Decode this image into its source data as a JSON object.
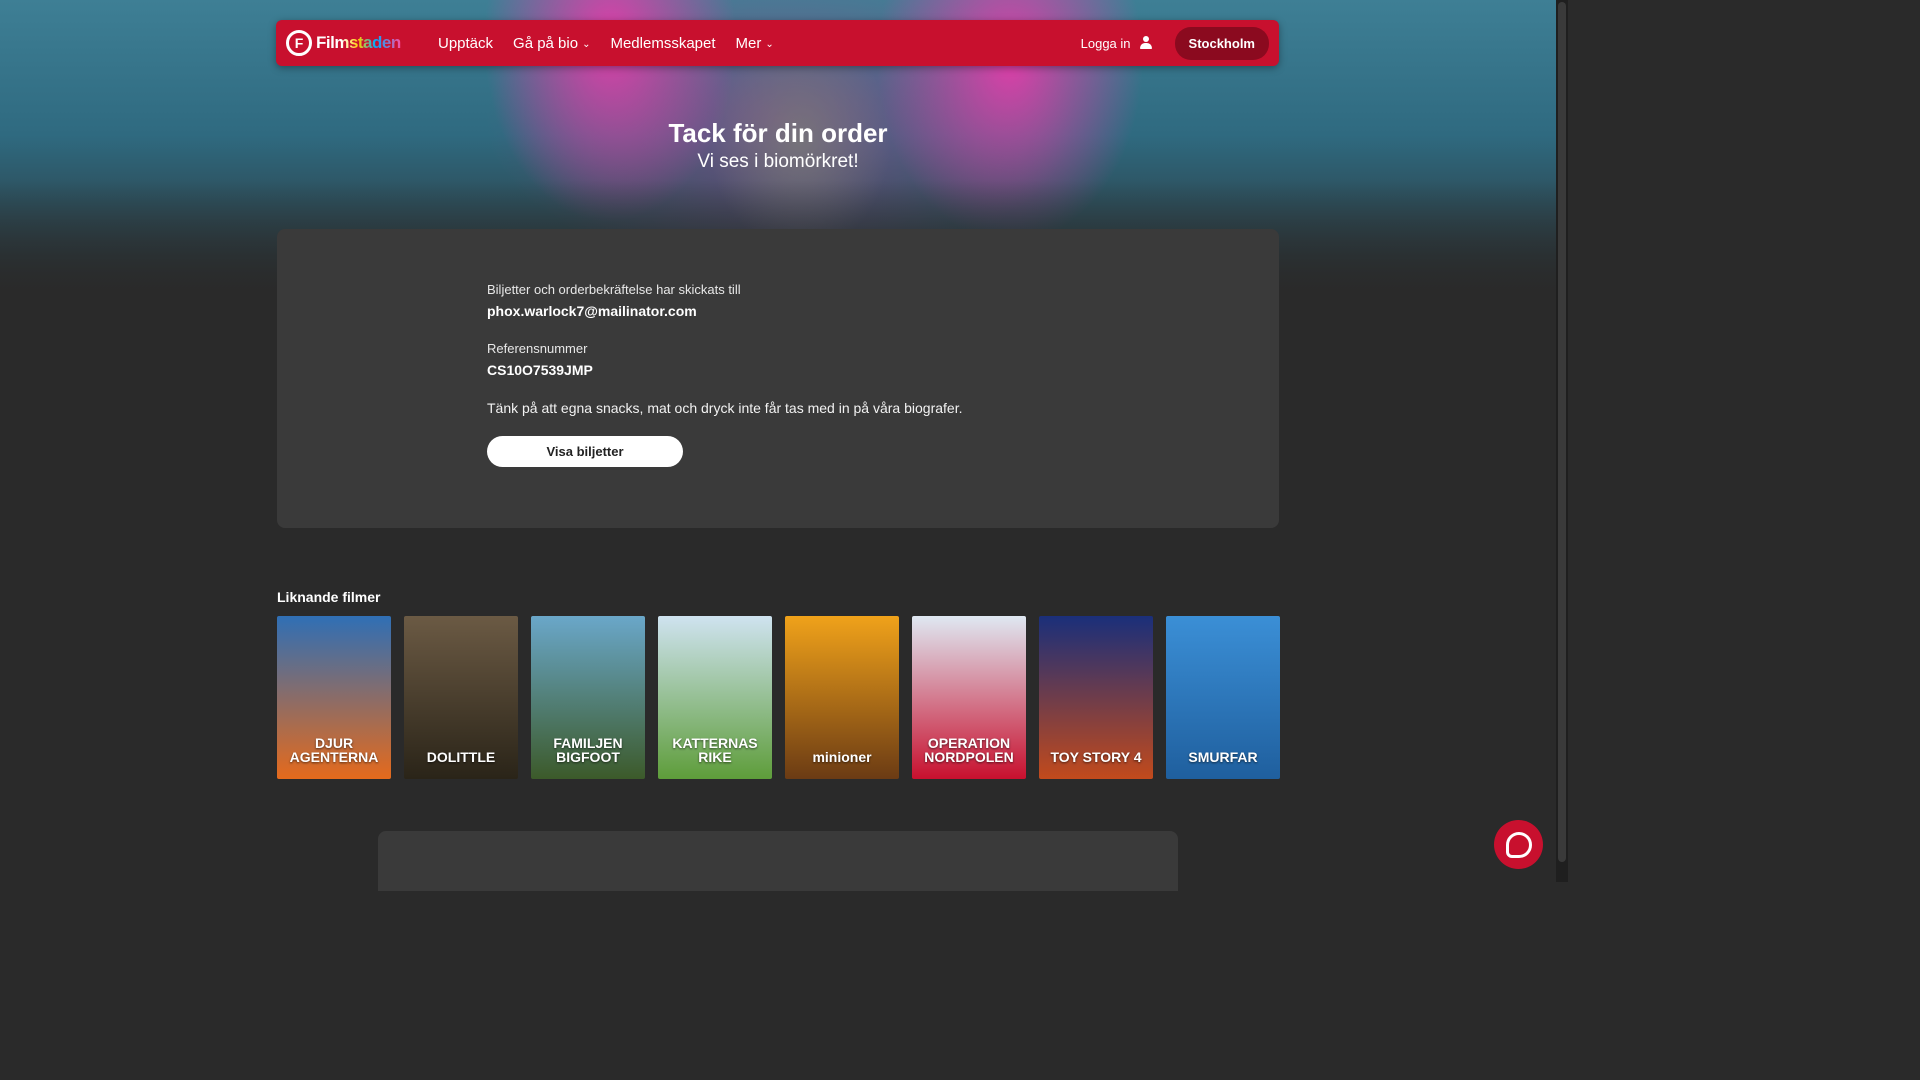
{
  "header": {
    "logo_text": "Filmstaden",
    "nav": [
      {
        "label": "Upptäck",
        "dropdown": false
      },
      {
        "label": "Gå på bio",
        "dropdown": true
      },
      {
        "label": "Medlemsskapet",
        "dropdown": false
      },
      {
        "label": "Mer",
        "dropdown": true
      }
    ],
    "login_label": "Logga in",
    "city_label": "Stockholm"
  },
  "hero": {
    "title": "Tack för din order",
    "subtitle": "Vi ses i biomörkret!"
  },
  "order": {
    "sent_label": "Biljetter och orderbekräftelse har skickats till",
    "email": "phox.warlock7@mailinator.com",
    "ref_label": "Referensnummer",
    "ref_value": "CS10O7539JMP",
    "notice": "Tänk på att egna snacks, mat och dryck inte får tas med in på våra biografer.",
    "view_button": "Visa biljetter"
  },
  "similar": {
    "title": "Liknande filmer",
    "posters": [
      {
        "text": "DJUR AGENTERNA",
        "bg": "#2f6fb5",
        "bg2": "#e56a1c"
      },
      {
        "text": "DOLITTLE",
        "bg": "#6b5a44",
        "bg2": "#2a2418"
      },
      {
        "text": "FAMILJEN BIGFOOT",
        "bg": "#6aa7c9",
        "bg2": "#3c5a2a"
      },
      {
        "text": "KATTERNAS RIKE",
        "bg": "#cfe3f0",
        "bg2": "#5e9d3a"
      },
      {
        "text": "minioner",
        "bg": "#f0a21a",
        "bg2": "#6b3b14"
      },
      {
        "text": "OPERATION NORDPOLEN",
        "bg": "#dfe8f2",
        "bg2": "#c8102e"
      },
      {
        "text": "TOY STORY 4",
        "bg": "#1a2f7a",
        "bg2": "#c24a1c"
      },
      {
        "text": "SMURFAR",
        "bg": "#3b8fd6",
        "bg2": "#1f5f9e"
      }
    ]
  }
}
